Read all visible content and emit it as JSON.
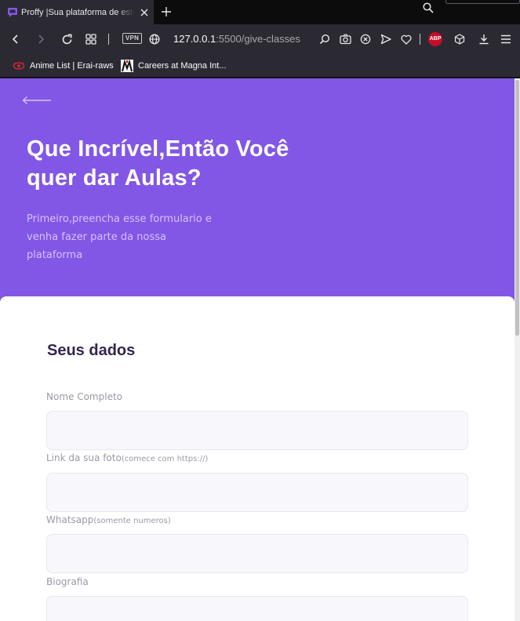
{
  "tab": {
    "title": "Proffy |Sua plataforma de estudos online",
    "favicon": "chat-bubble-icon",
    "accent": "#8257e5"
  },
  "toolbar": {
    "vpn_label": "VPN",
    "url_host": "127.0.0.1",
    "url_rest": ":5500/give-classes",
    "abp_label": "ABP"
  },
  "bookmarks": [
    {
      "label": "Anime List | Erai-raws",
      "icon": "erai-raws-icon"
    },
    {
      "label": "Careers at Magna Int...",
      "icon": "magna-logo-icon"
    }
  ],
  "page": {
    "hero": {
      "title_line1": "Que Incrível,Então Você",
      "title_line2": "quer dar Aulas?",
      "desc_line1": "Primeiro,preencha esse formulario e",
      "desc_line2": "venha fazer parte da nossa",
      "desc_line3": "plataforma",
      "background": "#8257e5"
    },
    "form": {
      "section_title": "Seus dados",
      "fields": [
        {
          "label": "Nome Completo",
          "hint": "",
          "value": ""
        },
        {
          "label": "Link da sua foto",
          "hint": "(comece com https://)",
          "value": ""
        },
        {
          "label": "Whatsapp",
          "hint": "(somente numeros)",
          "value": ""
        },
        {
          "label": "Biografia",
          "hint": "",
          "value": ""
        }
      ]
    }
  }
}
